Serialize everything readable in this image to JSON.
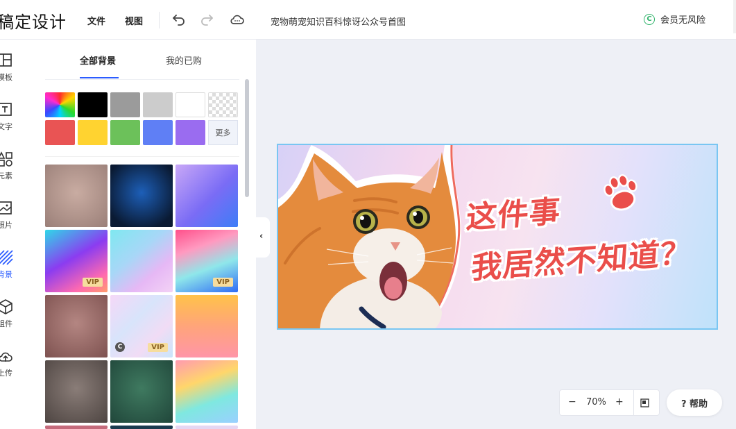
{
  "app": {
    "logo": "稿定设计"
  },
  "header": {
    "menus": [
      "文件",
      "视图"
    ],
    "doc_title": "宠物萌宠知识百科惊讶公众号首图",
    "member_label": "会员无风险"
  },
  "rail": [
    {
      "label": "模板",
      "icon": "template-icon"
    },
    {
      "label": "文字",
      "icon": "text-icon"
    },
    {
      "label": "元素",
      "icon": "elements-icon"
    },
    {
      "label": "照片",
      "icon": "photo-icon"
    },
    {
      "label": "背景",
      "icon": "background-icon",
      "active": true
    },
    {
      "label": "组件",
      "icon": "component-icon"
    },
    {
      "label": "上传",
      "icon": "upload-icon"
    }
  ],
  "panel": {
    "tabs": [
      "全部背景",
      "我的已购"
    ],
    "active_tab": 0,
    "more_label": "更多",
    "swatch_colors": [
      "#000000",
      "#9b9b9b",
      "#cccccc",
      "#ffffff",
      "#e95454",
      "#ffd330",
      "#6cc15a",
      "#5f7ff5",
      "#9a6cf0"
    ],
    "vip_label": "VIP",
    "c_badge": "C"
  },
  "canvas": {
    "headline_line1": "这件事",
    "headline_line2": "我居然不知道？"
  },
  "zoom": {
    "minus": "−",
    "value": "70%",
    "plus": "+"
  },
  "help": {
    "label": "? 帮助"
  }
}
